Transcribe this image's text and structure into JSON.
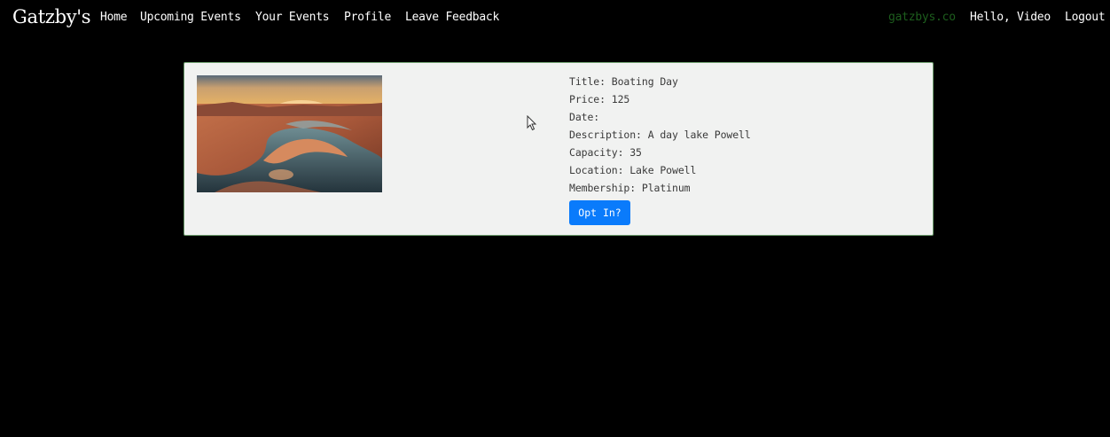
{
  "navbar": {
    "brand": "Gatzby's",
    "links": {
      "home": "Home",
      "upcoming_events": "Upcoming Events",
      "your_events": "Your Events",
      "profile": "Profile",
      "leave_feedback": "Leave Feedback"
    },
    "site_link": "gatzbys.co",
    "greeting": "Hello, Video",
    "logout": "Logout",
    "colors": {
      "background": "#000000",
      "link": "#ffffff",
      "site_link": "#1d5e1d"
    }
  },
  "event_card": {
    "image_icon": "canyon-lake-photo",
    "details": {
      "title": "Title: Boating Day",
      "price": "Price: 125",
      "date": "Date:",
      "description": "Description: A day lake Powell",
      "capacity": "Capacity: 35",
      "location": "Location: Lake Powell",
      "membership": "Membership: Platinum"
    },
    "opt_in_label": "Opt In?",
    "colors": {
      "card_background": "#f1f2f1",
      "button": "#0a7bfb"
    }
  }
}
